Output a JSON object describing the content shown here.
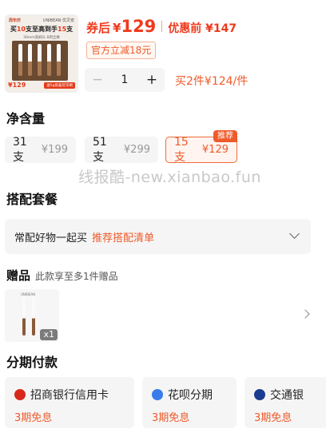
{
  "product": {
    "thumbnail": {
      "header_left": "周年庆",
      "header_brand": "UNIBEAN 优贝安",
      "promo_pre": "买",
      "promo_num1": "10",
      "promo_mid": "支至高到手",
      "promo_num2": "15",
      "promo_post": "支",
      "sub": "30mm宽刷头  8周全换",
      "price": "¥129",
      "tag": "送5g角鲨烷牙刷"
    },
    "price_after_label": "券后",
    "price_symbol": "¥",
    "price_after_value": "129",
    "price_before": "优惠前 ¥147",
    "coupon": "官方立减18元",
    "quantity": "1",
    "minus_label": "−",
    "plus_label": "+",
    "buy_two": "买2件¥124/件"
  },
  "net_content": {
    "title": "净含量",
    "options": [
      {
        "label": "31支",
        "price": "¥199",
        "selected": false
      },
      {
        "label": "51支",
        "price": "¥299",
        "selected": false
      },
      {
        "label": "15支",
        "price": "¥129",
        "selected": true,
        "badge": "推荐"
      }
    ]
  },
  "watermark": "线报酷-new.xianbao.fun",
  "combo": {
    "title": "搭配套餐",
    "text": "常配好物一起买",
    "link": "推荐搭配清单"
  },
  "gift": {
    "title": "赠品",
    "subtitle": "此款享至多1件赠品",
    "brand": "UNIBEAN",
    "count": "x1"
  },
  "installment": {
    "title": "分期付款",
    "cards": [
      {
        "name": "招商银行信用卡",
        "term": "3期免息",
        "icon_color": "#d8281c"
      },
      {
        "name": "花呗分期",
        "term": "3期免息",
        "icon_color": "#3a7bea"
      },
      {
        "name": "交通银",
        "term": "3期免息",
        "icon_color": "#1a3d8f"
      }
    ]
  }
}
